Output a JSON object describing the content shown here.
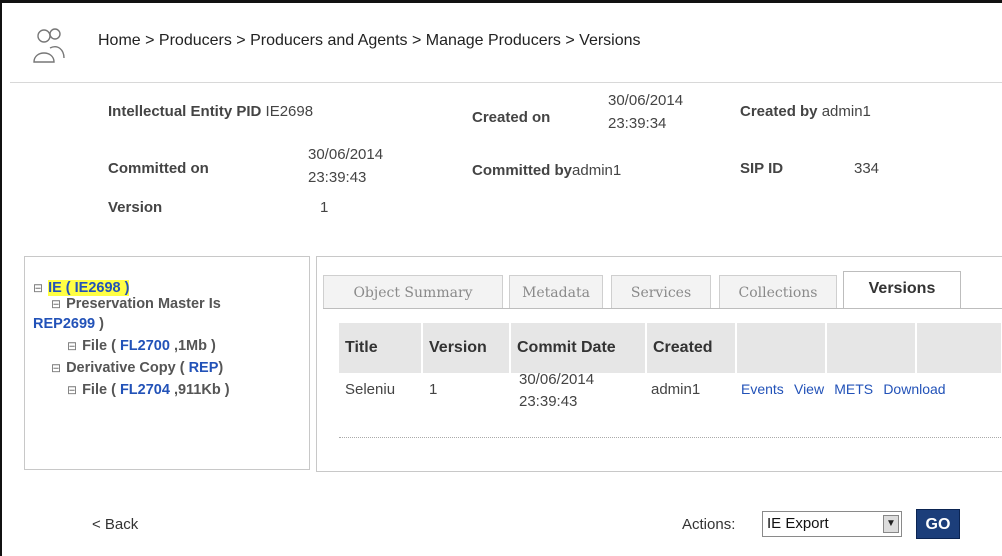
{
  "breadcrumb": "Home > Producers > Producers and Agents > Manage Producers > Versions",
  "meta": {
    "ie_pid_label": "Intellectual Entity PID",
    "ie_pid_value": "IE2698",
    "created_on_label": "Created on",
    "created_on_date": "30/06/2014",
    "created_on_time": "23:39:34",
    "created_by_label": "Created by",
    "created_by_value": "admin1",
    "committed_on_label": "Committed on",
    "committed_on_date": "30/06/2014",
    "committed_on_time": "23:39:43",
    "committed_by_label": "Committed by",
    "committed_by_value": "admin1",
    "sip_id_label": "SIP ID",
    "sip_id_value": "334",
    "version_label": "Version",
    "version_value": "1"
  },
  "tree": {
    "ie_prefix": "IE ( ",
    "ie_id": "IE2698",
    "ie_suffix": " )",
    "preservation_label": "Preservation Master Is",
    "preservation_id": "REP2699",
    "preservation_suffix": " )",
    "file1_prefix": "File ( ",
    "file1_id": "FL2700",
    "file1_suffix": " ,1Mb )",
    "derivative_prefix": "Derivative Copy ( ",
    "derivative_id": "REP",
    "derivative_suffix": ")",
    "file2_prefix": "File ( ",
    "file2_id": "FL2704",
    "file2_suffix": " ,911Kb )"
  },
  "tabs": [
    "Object Summary",
    "Metadata",
    "Services",
    "Collections",
    "Versions"
  ],
  "table": {
    "headers": [
      "Title",
      "Version",
      "Commit Date",
      "Created"
    ],
    "row": {
      "title": "Seleniu",
      "version": "1",
      "commit_date": "30/06/2014",
      "commit_time": "23:39:43",
      "created": "admin1",
      "links": [
        "Events",
        "View",
        "METS",
        "Download"
      ]
    }
  },
  "footer": {
    "back": "< Back",
    "actions_label": "Actions:",
    "actions_value": "IE Export",
    "go": "GO"
  },
  "colors": {
    "link": "#2252b8",
    "highlight": "#ffff44",
    "go_button": "#1c3e7a"
  },
  "icons": {
    "header": "users-icon",
    "tree_expander": "minus-box-icon",
    "select_arrow": "chevron-down-icon"
  }
}
